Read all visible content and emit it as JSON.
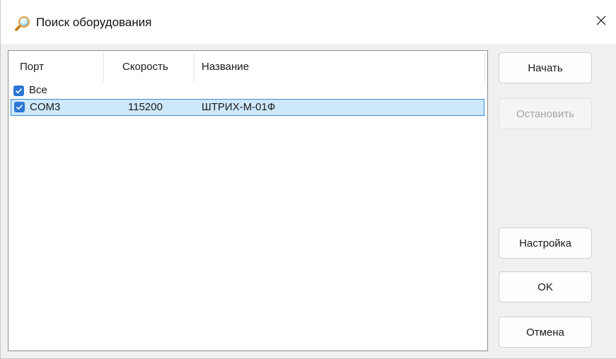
{
  "window": {
    "title": "Поиск оборудования",
    "title_icon": "magnifier-icon",
    "close_icon": "close-icon"
  },
  "table": {
    "columns": [
      "Порт",
      "Скорость",
      "Название"
    ],
    "rows": [
      {
        "checked": true,
        "port": "Все",
        "speed": "",
        "name": "",
        "selected": false
      },
      {
        "checked": true,
        "port": "COM3",
        "speed": "115200",
        "name": "ШТРИХ-М-01Ф",
        "selected": true
      }
    ]
  },
  "buttons": {
    "start": "Начать",
    "stop": "Остановить",
    "settings": "Настройка",
    "ok": "OK",
    "cancel": "Отмена"
  },
  "colors": {
    "checkbox": "#2c77d4",
    "selection_bg": "#cde8fa",
    "selection_border": "#3d8ad6"
  }
}
